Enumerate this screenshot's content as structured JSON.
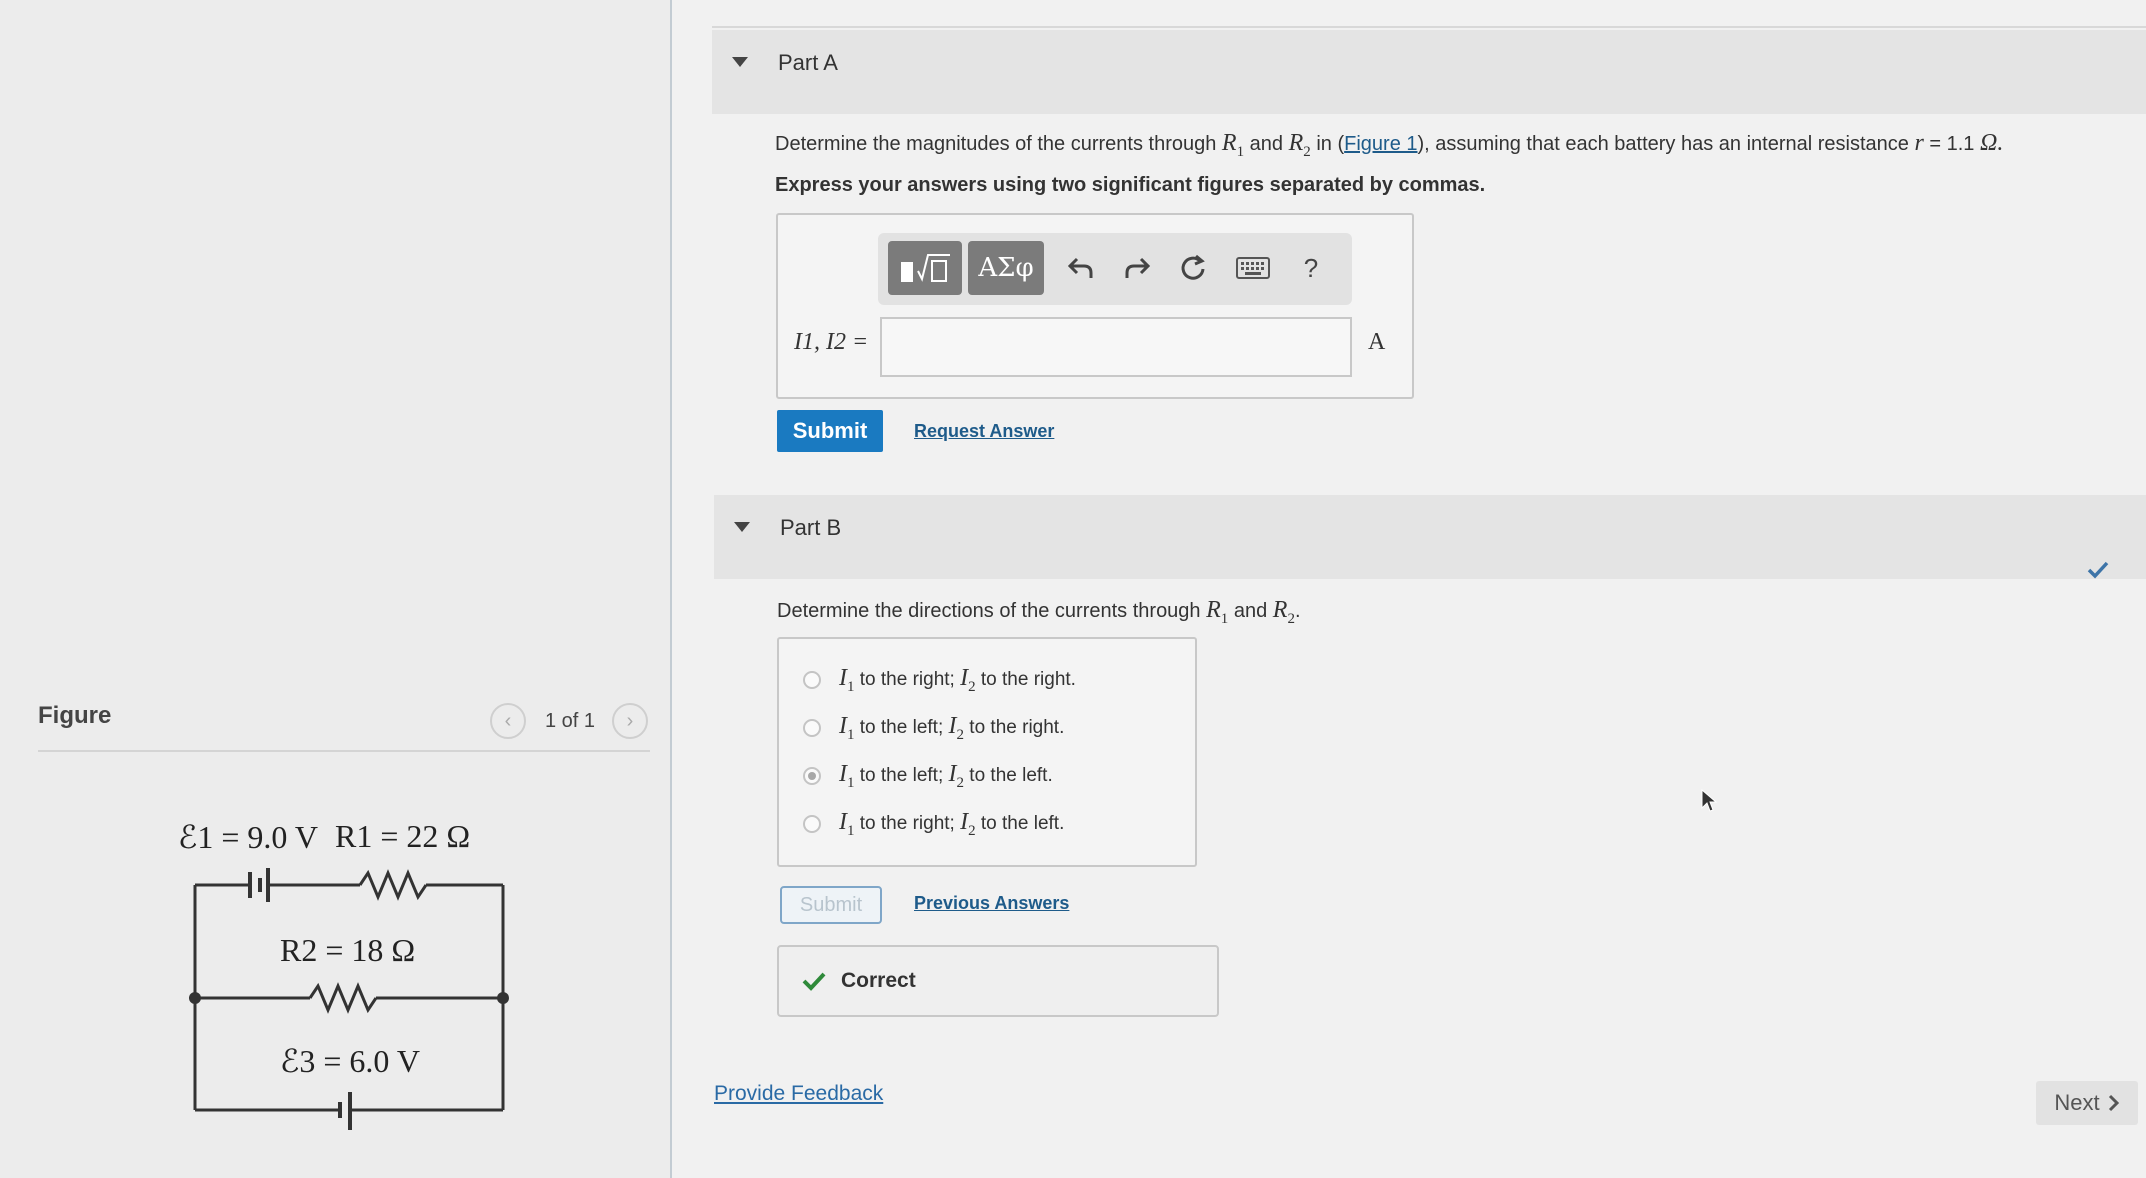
{
  "figure": {
    "label": "Figure",
    "pager": {
      "prev_icon": "chevron-left-icon",
      "text": "1 of 1",
      "next_icon": "chevron-right-icon"
    },
    "circuit": {
      "e1_label": "ℰ1 = 9.0 V",
      "r1_label": "R1 = 22 Ω",
      "r2_label": "R2 = 18 Ω",
      "e3_label": "ℰ3 = 6.0 V"
    }
  },
  "part_a": {
    "title": "Part A",
    "question_pre": "Determine the magnitudes of the currents through",
    "r1": "R",
    "and_word": "and",
    "r2": "R",
    "in_word": "in (",
    "figure_link": "Figure 1",
    "question_post": "), assuming that each battery has an internal resistance",
    "r_symbol": "r",
    "r_value": "= 1.1",
    "r_unit": "Ω.",
    "instruction": "Express your answers using two significant figures separated by commas.",
    "toolbar": {
      "template_icon": "sqrt-template-icon",
      "greek_label": "ΑΣφ",
      "undo_icon": "undo-icon",
      "redo_icon": "redo-icon",
      "reset_icon": "reset-icon",
      "keyboard_icon": "keyboard-icon",
      "help_label": "?"
    },
    "input_label": "I1, I2 =",
    "input_value": "",
    "unit": "A",
    "submit_label": "Submit",
    "request_answer_label": "Request Answer"
  },
  "part_b": {
    "title": "Part B",
    "question_pre": "Determine the directions of the currents through",
    "and_word": "and",
    "options": [
      {
        "text": "I1 to the right; I2 to the right.",
        "a": "to the right;",
        "b": "to the right.",
        "selected": false
      },
      {
        "text": "I1 to the left; I2 to the right.",
        "a": "to the left;",
        "b": "to the right.",
        "selected": false
      },
      {
        "text": "I1 to the left; I2 to the left.",
        "a": "to the left;",
        "b": "to the left.",
        "selected": true
      },
      {
        "text": "I1 to the right; I2 to the left.",
        "a": "to the right;",
        "b": "to the left.",
        "selected": false
      }
    ],
    "submit_label": "Submit",
    "previous_answers_label": "Previous Answers",
    "result": "Correct",
    "result_icon": "checkmark-icon",
    "completed_icon": "checkmark-icon"
  },
  "footer": {
    "feedback_label": "Provide Feedback",
    "next_label": "Next"
  },
  "colors": {
    "accent_blue": "#1a7ac1",
    "link_blue": "#1e5b8a",
    "success_green": "#2f8a3a",
    "checkmark_blue": "#3d74a8"
  }
}
